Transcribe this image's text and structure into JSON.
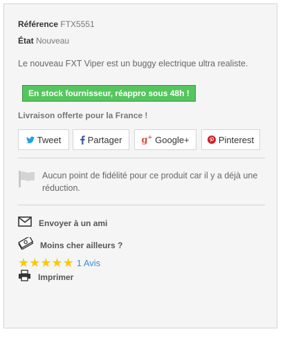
{
  "product": {
    "reference_label": "Référence",
    "reference_value": "FTX5551",
    "etat_label": "État",
    "etat_value": "Nouveau",
    "description": "Le nouveau FXT Viper est un buggy electrique ultra realiste.",
    "stock_badge": "En stock fournisseur, réappro sous 48h !",
    "shipping_note": "Livraison offerte pour la France !"
  },
  "share_buttons": [
    {
      "label": "Tweet",
      "icon": "twitter-icon",
      "color": "#1da1f2"
    },
    {
      "label": "Partager",
      "icon": "facebook-icon",
      "color": "#3b5998"
    },
    {
      "label": "Google+",
      "icon": "google-plus-icon",
      "color": "#dd4b39"
    },
    {
      "label": "Pinterest",
      "icon": "pinterest-icon",
      "color": "#cb2027"
    }
  ],
  "loyalty": {
    "icon": "flag-icon",
    "text": "Aucun point de fidélité pour ce produit car il y a déjà une réduction."
  },
  "links": {
    "send_friend": "Envoyer à un ami",
    "cheaper": "Moins cher ailleurs ?",
    "print": "Imprimer"
  },
  "rating": {
    "stars": 5,
    "max_stars": 5,
    "reviews_label": "1 Avis"
  },
  "colors": {
    "stock_green": "#55c65e",
    "star_yellow": "#f9c90a",
    "link_blue": "#3a8fd8"
  }
}
